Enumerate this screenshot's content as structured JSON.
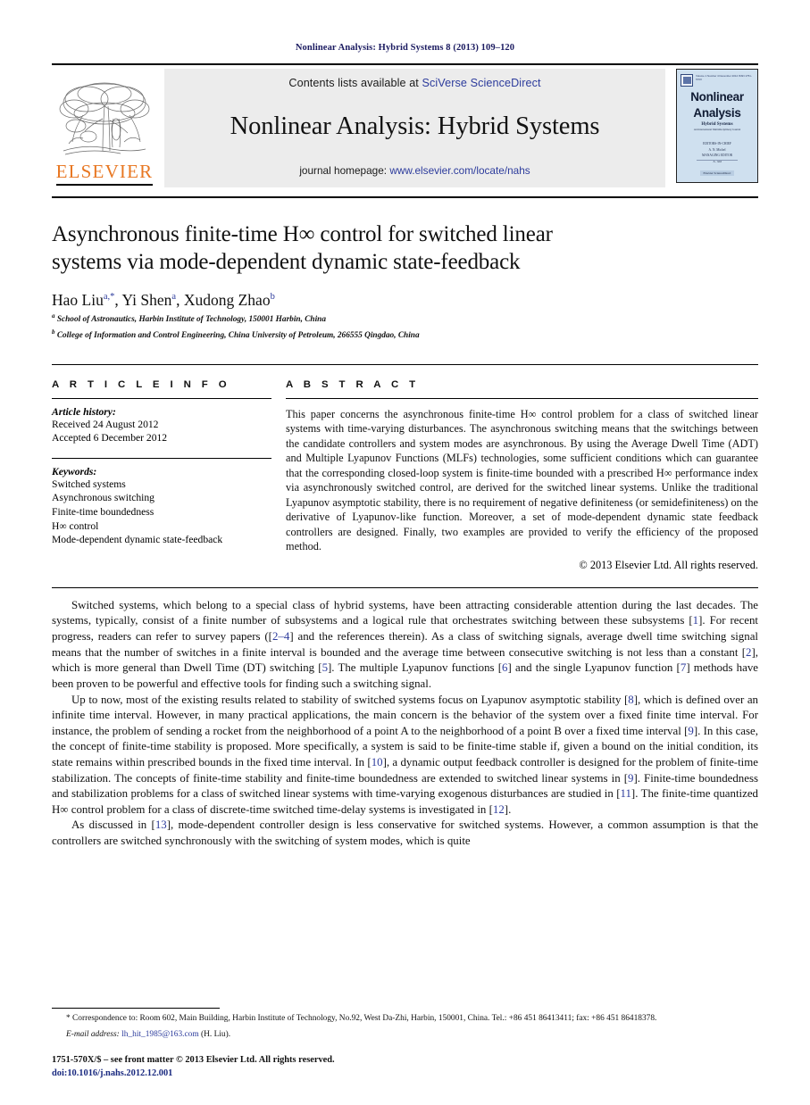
{
  "running_head": "Nonlinear Analysis: Hybrid Systems 8 (2013) 109–120",
  "masthead": {
    "contents_prefix": "Contents lists available at ",
    "sciencedirect_link": "SciVerse ScienceDirect",
    "journal_title": "Nonlinear Analysis: Hybrid Systems",
    "homepage_prefix": "journal homepage: ",
    "homepage_link": "www.elsevier.com/locate/nahs",
    "publisher": "ELSEVIER",
    "link_color": "#2c3b9c",
    "panel_color": "#ececec",
    "elsevier_orange": "#E87722"
  },
  "cover": {
    "issue_line": "Volume 1    Number 4    December 2012    ISSN 1751-570X",
    "title_line1": "Nonlinear",
    "title_line2": "Analysis",
    "subtitle": "Hybrid Systems",
    "subtitle2": "An International Multidisciplinary Journal",
    "mid_line1": "EDITORS-IN-CHIEF",
    "mid_line2": "A. N. Michel",
    "mid_line3": "MANAGING EDITOR",
    "mid_line4": "X. Xia",
    "footer_badge": "Elsevier ScienceDirect",
    "bg_color": "#cfe0ef"
  },
  "article": {
    "title_line1": "Asynchronous finite-time H∞ control for switched linear",
    "title_line2": "systems via mode-dependent dynamic state-feedback",
    "authors": [
      {
        "name": "Hao Liu",
        "sup": "a,*"
      },
      {
        "name": "Yi Shen",
        "sup": "a"
      },
      {
        "name": "Xudong Zhao",
        "sup": "b"
      }
    ],
    "affiliations": [
      {
        "marker": "a",
        "text": "School of Astronautics, Harbin Institute of Technology, 150001 Harbin, China"
      },
      {
        "marker": "b",
        "text": "College of Information and Control Engineering, China University of Petroleum, 266555 Qingdao, China"
      }
    ]
  },
  "article_info": {
    "heading": "A R T I C L E    I N F O",
    "history_label": "Article history:",
    "received": "Received 24 August 2012",
    "accepted": "Accepted 6 December 2012",
    "keywords_label": "Keywords:",
    "keywords": [
      "Switched systems",
      "Asynchronous switching",
      "Finite-time boundedness",
      "H∞ control",
      "Mode-dependent dynamic state-feedback"
    ]
  },
  "abstract": {
    "heading": "A B S T R A C T",
    "text": "This paper concerns the asynchronous finite-time H∞ control problem for a class of switched linear systems with time-varying disturbances. The asynchronous switching means that the switchings between the candidate controllers and system modes are asynchronous. By using the Average Dwell Time (ADT) and Multiple Lyapunov Functions (MLFs) technologies, some sufficient conditions which can guarantee that the corresponding closed-loop system is finite-time bounded with a prescribed H∞ performance index via asynchronously switched control, are derived for the switched linear systems. Unlike the traditional Lyapunov asymptotic stability, there is no requirement of negative definiteness (or semidefiniteness) on the derivative of Lyapunov-like function. Moreover, a set of mode-dependent dynamic state feedback controllers are designed. Finally, two examples are provided to verify the efficiency of the proposed method.",
    "copyright": "© 2013 Elsevier Ltd. All rights reserved."
  },
  "body": {
    "paragraph1_parts": [
      {
        "t": "Switched systems, which belong to a special class of hybrid systems, have been attracting considerable attention during the last decades. The systems, typically, consist of a finite number of subsystems and a logical rule that orchestrates switching between these subsystems [",
        "ref": false
      },
      {
        "t": "1",
        "ref": true
      },
      {
        "t": "]. For recent progress, readers can refer to survey papers ([",
        "ref": false
      },
      {
        "t": "2–4",
        "ref": true
      },
      {
        "t": "] and the references therein). As a class of switching signals, average dwell time switching signal means that the number of switches in a finite interval is bounded and the average time between consecutive switching is not less than a constant [",
        "ref": false
      },
      {
        "t": "2",
        "ref": true
      },
      {
        "t": "], which is more general than Dwell Time (DT) switching [",
        "ref": false
      },
      {
        "t": "5",
        "ref": true
      },
      {
        "t": "]. The multiple Lyapunov functions [",
        "ref": false
      },
      {
        "t": "6",
        "ref": true
      },
      {
        "t": "] and the single Lyapunov function [",
        "ref": false
      },
      {
        "t": "7",
        "ref": true
      },
      {
        "t": "] methods have been proven to be powerful and effective tools for finding such a switching signal.",
        "ref": false
      }
    ],
    "paragraph2_parts": [
      {
        "t": "Up to now, most of the existing results related to stability of switched systems focus on Lyapunov asymptotic stability [",
        "ref": false
      },
      {
        "t": "8",
        "ref": true
      },
      {
        "t": "], which is defined over an infinite time interval. However, in many practical applications, the main concern is the behavior of the system over a fixed finite time interval. For instance, the problem of sending a rocket from the neighborhood of a point A to the neighborhood of a point B over a fixed time interval [",
        "ref": false
      },
      {
        "t": "9",
        "ref": true
      },
      {
        "t": "]. In this case, the concept of finite-time stability is proposed. More specifically, a system is said to be finite-time stable if, given a bound on the initial condition, its state remains within prescribed bounds in the fixed time interval. In [",
        "ref": false
      },
      {
        "t": "10",
        "ref": true
      },
      {
        "t": "], a dynamic output feedback controller is designed for the problem of finite-time stabilization. The concepts of finite-time stability and finite-time boundedness are extended to switched linear systems in [",
        "ref": false
      },
      {
        "t": "9",
        "ref": true
      },
      {
        "t": "]. Finite-time boundedness and stabilization problems for a class of switched linear systems with time-varying exogenous disturbances are studied in [",
        "ref": false
      },
      {
        "t": "11",
        "ref": true
      },
      {
        "t": "]. The finite-time quantized H∞ control problem for a class of discrete-time switched time-delay systems is investigated in [",
        "ref": false
      },
      {
        "t": "12",
        "ref": true
      },
      {
        "t": "].",
        "ref": false
      }
    ],
    "paragraph3_parts": [
      {
        "t": "As discussed in [",
        "ref": false
      },
      {
        "t": "13",
        "ref": true
      },
      {
        "t": "], mode-dependent controller design is less conservative for switched systems. However, a common assumption is that the controllers are switched synchronously with the switching of system modes, which is quite",
        "ref": false
      }
    ]
  },
  "footnotes": {
    "correspondence": "Correspondence to: Room 602, Main Building, Harbin Institute of Technology, No.92, West Da-Zhi, Harbin, 150001, China. Tel.: +86 451 86413411; fax: +86 451 86418378.",
    "email_label": "E-mail address:",
    "email": "lh_hit_1985@163.com",
    "email_owner": "(H. Liu).",
    "imprint": "1751-570X/$ – see front matter © 2013 Elsevier Ltd. All rights reserved.",
    "doi": "doi:10.1016/j.nahs.2012.12.001"
  }
}
